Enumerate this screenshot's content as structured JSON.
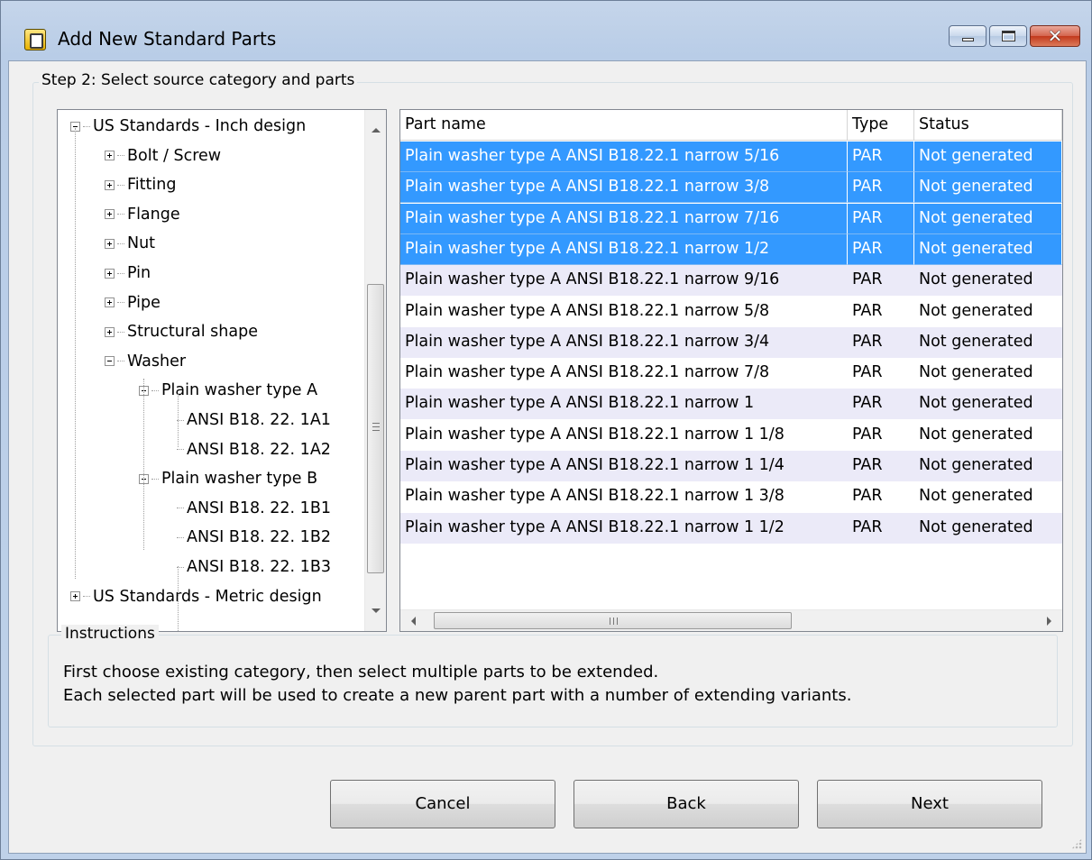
{
  "window": {
    "title": "Add New Standard Parts",
    "close_glyph": "✕"
  },
  "step": {
    "label": "Step 2: Select source category and parts"
  },
  "tree": {
    "items": [
      {
        "label": "US Standards - Inch design",
        "expander": "minus"
      },
      {
        "label": "Bolt / Screw",
        "expander": "plus"
      },
      {
        "label": "Fitting",
        "expander": "plus"
      },
      {
        "label": "Flange",
        "expander": "plus"
      },
      {
        "label": "Nut",
        "expander": "plus"
      },
      {
        "label": "Pin",
        "expander": "plus"
      },
      {
        "label": "Pipe",
        "expander": "plus"
      },
      {
        "label": "Structural shape",
        "expander": "plus"
      },
      {
        "label": "Washer",
        "expander": "minus"
      },
      {
        "label": "Plain washer type A",
        "expander": "minus"
      },
      {
        "label": "ANSI B18. 22. 1A1",
        "expander": "none"
      },
      {
        "label": "ANSI B18. 22. 1A2",
        "expander": "none"
      },
      {
        "label": "Plain washer type B",
        "expander": "minus"
      },
      {
        "label": "ANSI B18. 22. 1B1",
        "expander": "none"
      },
      {
        "label": "ANSI B18. 22. 1B2",
        "expander": "none"
      },
      {
        "label": "ANSI B18. 22. 1B3",
        "expander": "none"
      },
      {
        "label": "US Standards - Metric design",
        "expander": "plus"
      }
    ]
  },
  "grid": {
    "columns": [
      "Part name",
      "Type",
      "Status"
    ],
    "rows": [
      {
        "name": "Plain washer type A ANSI B18.22.1 narrow 5/16",
        "type": "PAR",
        "status": "Not generated",
        "selected": true
      },
      {
        "name": "Plain washer type A ANSI B18.22.1 narrow 3/8",
        "type": "PAR",
        "status": "Not generated",
        "selected": true
      },
      {
        "name": "Plain washer type A ANSI B18.22.1 narrow 7/16",
        "type": "PAR",
        "status": "Not generated",
        "selected": true
      },
      {
        "name": "Plain washer type A ANSI B18.22.1 narrow 1/2",
        "type": "PAR",
        "status": "Not generated",
        "selected": true
      },
      {
        "name": "Plain washer type A ANSI B18.22.1 narrow 9/16",
        "type": "PAR",
        "status": "Not generated",
        "selected": false
      },
      {
        "name": "Plain washer type A ANSI B18.22.1 narrow 5/8",
        "type": "PAR",
        "status": "Not generated",
        "selected": false
      },
      {
        "name": "Plain washer type A ANSI B18.22.1 narrow 3/4",
        "type": "PAR",
        "status": "Not generated",
        "selected": false
      },
      {
        "name": "Plain washer type A ANSI B18.22.1 narrow 7/8",
        "type": "PAR",
        "status": "Not generated",
        "selected": false
      },
      {
        "name": "Plain washer type A ANSI B18.22.1 narrow 1",
        "type": "PAR",
        "status": "Not generated",
        "selected": false
      },
      {
        "name": "Plain washer type A ANSI B18.22.1 narrow 1 1/8",
        "type": "PAR",
        "status": "Not generated",
        "selected": false
      },
      {
        "name": "Plain washer type A ANSI B18.22.1 narrow 1 1/4",
        "type": "PAR",
        "status": "Not generated",
        "selected": false
      },
      {
        "name": "Plain washer type A ANSI B18.22.1 narrow 1 3/8",
        "type": "PAR",
        "status": "Not generated",
        "selected": false
      },
      {
        "name": "Plain washer type A ANSI B18.22.1 narrow 1 1/2",
        "type": "PAR",
        "status": "Not generated",
        "selected": false
      }
    ],
    "hscroll_grip": "III"
  },
  "instructions": {
    "title": "Instructions",
    "line1": "First choose existing category, then select multiple parts to be extended.",
    "line2": "Each selected part will be used to create a new parent part with a number of extending variants."
  },
  "buttons": {
    "cancel": "Cancel",
    "back": "Back",
    "next": "Next"
  },
  "colors": {
    "selection": "#3399ff",
    "alt_row": "#ebeaf8",
    "close_button": "#c2391c"
  },
  "icons": [
    "app-icon",
    "minimize-icon",
    "maximize-icon",
    "close-icon",
    "scroll-up-icon",
    "scroll-down-icon",
    "scroll-left-icon",
    "scroll-right-icon",
    "expand-icon",
    "collapse-icon",
    "resize-grip-icon"
  ]
}
